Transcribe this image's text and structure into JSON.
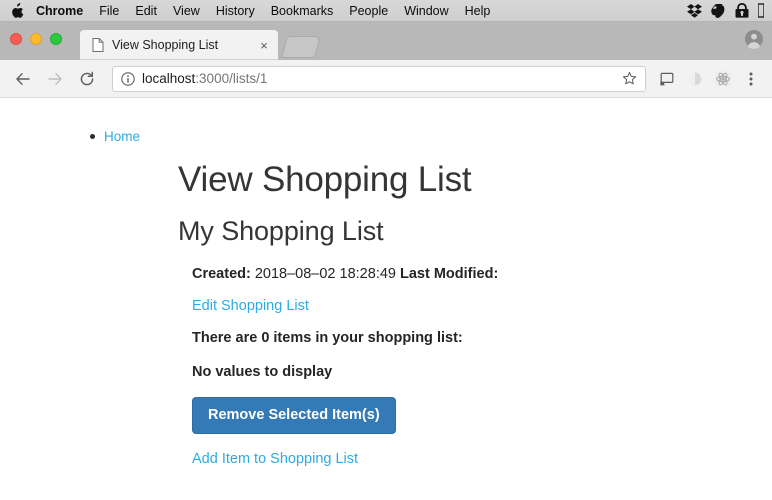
{
  "menubar": {
    "apple_icon": "apple-logo",
    "items": [
      {
        "label": "Chrome",
        "bold": true
      },
      {
        "label": "File",
        "bold": false
      },
      {
        "label": "Edit",
        "bold": false
      },
      {
        "label": "View",
        "bold": false
      },
      {
        "label": "History",
        "bold": false
      },
      {
        "label": "Bookmarks",
        "bold": false
      },
      {
        "label": "People",
        "bold": false
      },
      {
        "label": "Window",
        "bold": false
      },
      {
        "label": "Help",
        "bold": false
      }
    ],
    "status_icons": [
      "dropbox-icon",
      "evernote-icon",
      "lock-icon",
      "partial-icon"
    ]
  },
  "browser": {
    "window_controls": [
      "close-button",
      "minimize-button",
      "maximize-button"
    ],
    "tab": {
      "title": "View Shopping List",
      "favicon": "page-icon",
      "close": "×"
    },
    "new_tab_label": "new-tab-button",
    "profile_icon": "profile-avatar-icon",
    "toolbar": {
      "back": "back-arrow-icon",
      "forward": "forward-arrow-icon",
      "reload": "reload-icon",
      "site_info": "info-circle-icon",
      "url_host": "localhost",
      "url_rest": ":3000/lists/1",
      "url_full": "localhost:3000/lists/1",
      "bookmark": "star-icon",
      "cast": "cast-icon",
      "extension_circle": "circle-extension-icon",
      "extension_react": "react-devtools-icon",
      "menu": "three-dot-menu-icon"
    }
  },
  "page": {
    "breadcrumb": [
      {
        "label": "Home",
        "href": "#"
      }
    ],
    "title": "View Shopping List",
    "list_name": "My Shopping List",
    "created_label": "Created:",
    "created_value": "2018–08–02 18:28:49",
    "last_modified_label": "Last Modified:",
    "last_modified_value": "",
    "edit_link": "Edit Shopping List",
    "items_count_text": "There are 0 items in your shopping list:",
    "empty_text": "No values to display",
    "remove_button": "Remove Selected Item(s)",
    "add_item_link": "Add Item to Shopping List"
  },
  "colors": {
    "link": "#2eaae4",
    "button_bg": "#337ab7",
    "button_border": "#2e6da4",
    "text": "#252525",
    "heading": "#353535"
  }
}
